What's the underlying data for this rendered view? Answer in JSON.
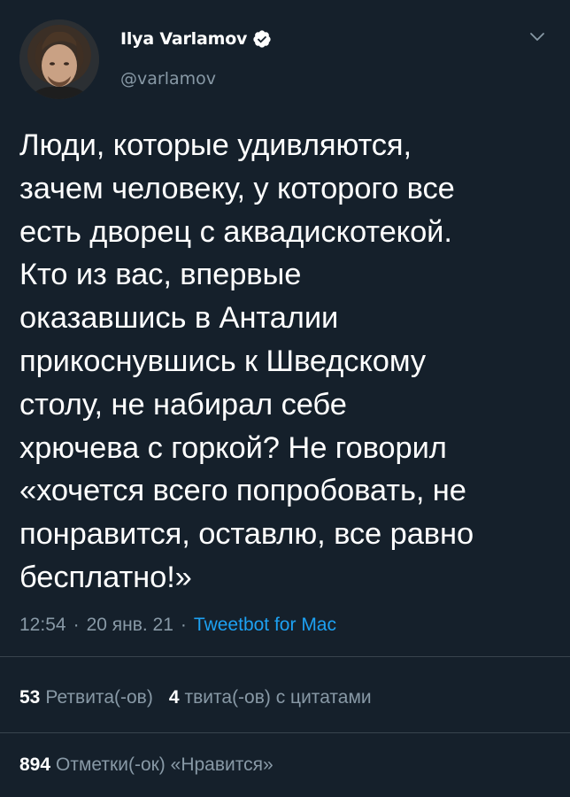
{
  "author": {
    "name": "Ilya Varlamov",
    "handle": "@varlamov",
    "verified_icon": "verified-badge",
    "verified_color": "#1da1f2"
  },
  "tweet": {
    "text": "Люди, которые удивляются,\nзачем человеку, у которого все\nесть дворец с аквадискотекой.\nКто из вас, впервые\nоказавшись в Анталии\nприкоснувшись к Шведскому\nстолу, не набирал себе\nхрючева с горкой? Не говорил\n«хочется всего попробовать, не\nпонравится, оставлю, все равно\nбесплатно!»"
  },
  "meta": {
    "time": "12:54",
    "separator1": "·",
    "date": "20 янв. 21",
    "separator2": "·",
    "source": "Tweetbot for Mac"
  },
  "stats": {
    "retweets_count": "53",
    "retweets_label": "Ретвита(-ов)",
    "quotes_count": "4",
    "quotes_label": "твита(-ов) с цитатами",
    "likes_count": "894",
    "likes_label": "Отметки(-ок) «Нравится»"
  },
  "colors": {
    "background": "#15202b",
    "text": "#ffffff",
    "secondary": "#8899a6",
    "accent": "#1da1f2",
    "divider": "#38444d"
  }
}
